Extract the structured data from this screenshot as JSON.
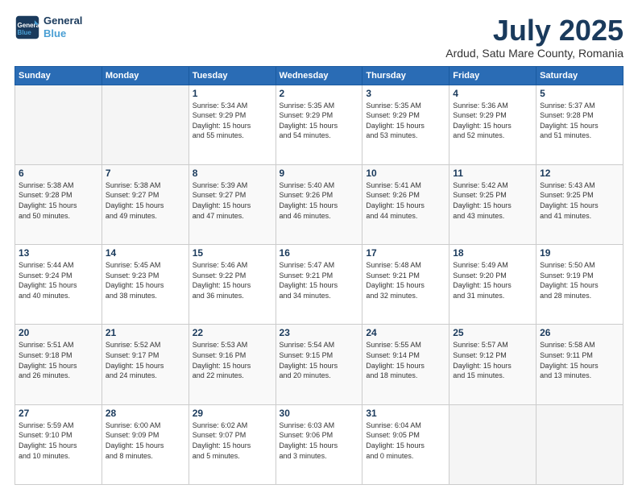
{
  "header": {
    "logo_line1": "General",
    "logo_line2": "Blue",
    "title": "July 2025",
    "location": "Ardud, Satu Mare County, Romania"
  },
  "weekdays": [
    "Sunday",
    "Monday",
    "Tuesday",
    "Wednesday",
    "Thursday",
    "Friday",
    "Saturday"
  ],
  "weeks": [
    [
      {
        "day": "",
        "info": ""
      },
      {
        "day": "",
        "info": ""
      },
      {
        "day": "1",
        "info": "Sunrise: 5:34 AM\nSunset: 9:29 PM\nDaylight: 15 hours\nand 55 minutes."
      },
      {
        "day": "2",
        "info": "Sunrise: 5:35 AM\nSunset: 9:29 PM\nDaylight: 15 hours\nand 54 minutes."
      },
      {
        "day": "3",
        "info": "Sunrise: 5:35 AM\nSunset: 9:29 PM\nDaylight: 15 hours\nand 53 minutes."
      },
      {
        "day": "4",
        "info": "Sunrise: 5:36 AM\nSunset: 9:29 PM\nDaylight: 15 hours\nand 52 minutes."
      },
      {
        "day": "5",
        "info": "Sunrise: 5:37 AM\nSunset: 9:28 PM\nDaylight: 15 hours\nand 51 minutes."
      }
    ],
    [
      {
        "day": "6",
        "info": "Sunrise: 5:38 AM\nSunset: 9:28 PM\nDaylight: 15 hours\nand 50 minutes."
      },
      {
        "day": "7",
        "info": "Sunrise: 5:38 AM\nSunset: 9:27 PM\nDaylight: 15 hours\nand 49 minutes."
      },
      {
        "day": "8",
        "info": "Sunrise: 5:39 AM\nSunset: 9:27 PM\nDaylight: 15 hours\nand 47 minutes."
      },
      {
        "day": "9",
        "info": "Sunrise: 5:40 AM\nSunset: 9:26 PM\nDaylight: 15 hours\nand 46 minutes."
      },
      {
        "day": "10",
        "info": "Sunrise: 5:41 AM\nSunset: 9:26 PM\nDaylight: 15 hours\nand 44 minutes."
      },
      {
        "day": "11",
        "info": "Sunrise: 5:42 AM\nSunset: 9:25 PM\nDaylight: 15 hours\nand 43 minutes."
      },
      {
        "day": "12",
        "info": "Sunrise: 5:43 AM\nSunset: 9:25 PM\nDaylight: 15 hours\nand 41 minutes."
      }
    ],
    [
      {
        "day": "13",
        "info": "Sunrise: 5:44 AM\nSunset: 9:24 PM\nDaylight: 15 hours\nand 40 minutes."
      },
      {
        "day": "14",
        "info": "Sunrise: 5:45 AM\nSunset: 9:23 PM\nDaylight: 15 hours\nand 38 minutes."
      },
      {
        "day": "15",
        "info": "Sunrise: 5:46 AM\nSunset: 9:22 PM\nDaylight: 15 hours\nand 36 minutes."
      },
      {
        "day": "16",
        "info": "Sunrise: 5:47 AM\nSunset: 9:21 PM\nDaylight: 15 hours\nand 34 minutes."
      },
      {
        "day": "17",
        "info": "Sunrise: 5:48 AM\nSunset: 9:21 PM\nDaylight: 15 hours\nand 32 minutes."
      },
      {
        "day": "18",
        "info": "Sunrise: 5:49 AM\nSunset: 9:20 PM\nDaylight: 15 hours\nand 31 minutes."
      },
      {
        "day": "19",
        "info": "Sunrise: 5:50 AM\nSunset: 9:19 PM\nDaylight: 15 hours\nand 28 minutes."
      }
    ],
    [
      {
        "day": "20",
        "info": "Sunrise: 5:51 AM\nSunset: 9:18 PM\nDaylight: 15 hours\nand 26 minutes."
      },
      {
        "day": "21",
        "info": "Sunrise: 5:52 AM\nSunset: 9:17 PM\nDaylight: 15 hours\nand 24 minutes."
      },
      {
        "day": "22",
        "info": "Sunrise: 5:53 AM\nSunset: 9:16 PM\nDaylight: 15 hours\nand 22 minutes."
      },
      {
        "day": "23",
        "info": "Sunrise: 5:54 AM\nSunset: 9:15 PM\nDaylight: 15 hours\nand 20 minutes."
      },
      {
        "day": "24",
        "info": "Sunrise: 5:55 AM\nSunset: 9:14 PM\nDaylight: 15 hours\nand 18 minutes."
      },
      {
        "day": "25",
        "info": "Sunrise: 5:57 AM\nSunset: 9:12 PM\nDaylight: 15 hours\nand 15 minutes."
      },
      {
        "day": "26",
        "info": "Sunrise: 5:58 AM\nSunset: 9:11 PM\nDaylight: 15 hours\nand 13 minutes."
      }
    ],
    [
      {
        "day": "27",
        "info": "Sunrise: 5:59 AM\nSunset: 9:10 PM\nDaylight: 15 hours\nand 10 minutes."
      },
      {
        "day": "28",
        "info": "Sunrise: 6:00 AM\nSunset: 9:09 PM\nDaylight: 15 hours\nand 8 minutes."
      },
      {
        "day": "29",
        "info": "Sunrise: 6:02 AM\nSunset: 9:07 PM\nDaylight: 15 hours\nand 5 minutes."
      },
      {
        "day": "30",
        "info": "Sunrise: 6:03 AM\nSunset: 9:06 PM\nDaylight: 15 hours\nand 3 minutes."
      },
      {
        "day": "31",
        "info": "Sunrise: 6:04 AM\nSunset: 9:05 PM\nDaylight: 15 hours\nand 0 minutes."
      },
      {
        "day": "",
        "info": ""
      },
      {
        "day": "",
        "info": ""
      }
    ]
  ]
}
